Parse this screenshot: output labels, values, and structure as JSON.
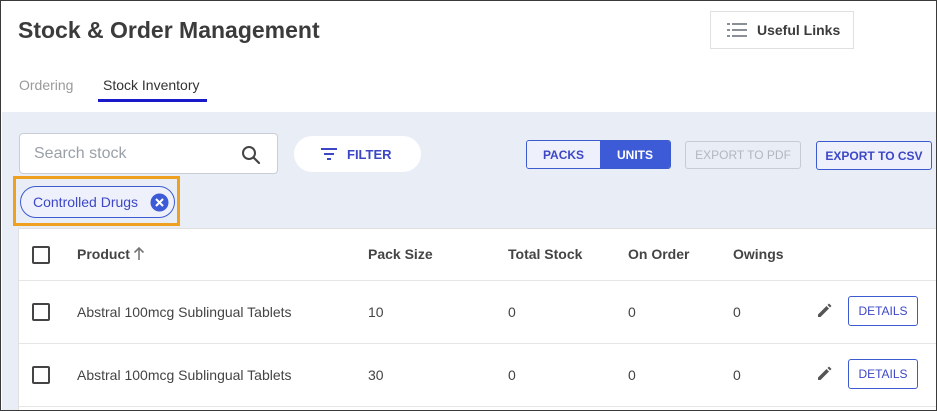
{
  "header": {
    "title": "Stock & Order Management",
    "useful_links": "Useful Links",
    "useful_links_icon": "list-icon"
  },
  "tabs": [
    {
      "label": "Ordering",
      "active": false
    },
    {
      "label": "Stock Inventory",
      "active": true
    }
  ],
  "toolbar": {
    "search_placeholder": "Search stock",
    "search_icon": "search-icon",
    "filter_label": "FILTER",
    "filter_icon": "filter-icon",
    "packs_label": "PACKS",
    "units_label": "UNITS",
    "selected_view": "UNITS",
    "export_pdf_label": "EXPORT TO PDF",
    "export_pdf_disabled": true,
    "export_csv_label": "EXPORT TO CSV"
  },
  "active_filters": [
    {
      "label": "Controlled Drugs",
      "remove_icon": "close-circle-icon"
    }
  ],
  "table": {
    "columns": [
      "Product",
      "Pack Size",
      "Total Stock",
      "On Order",
      "Owings"
    ],
    "sort": {
      "column": "Product",
      "direction": "asc",
      "icon": "arrow-up-icon"
    },
    "rows": [
      {
        "product": "Abstral 100mcg Sublingual Tablets",
        "pack_size": "10",
        "total_stock": "0",
        "on_order": "0",
        "owings": "0",
        "details_label": "DETAILS"
      },
      {
        "product": "Abstral 100mcg Sublingual Tablets",
        "pack_size": "30",
        "total_stock": "0",
        "on_order": "0",
        "owings": "0",
        "details_label": "DETAILS"
      }
    ]
  },
  "colors": {
    "accent": "#3d5bd6",
    "highlight": "#f0a020",
    "content_bg": "#e9eef6",
    "tab_underline": "#1a1acb"
  }
}
